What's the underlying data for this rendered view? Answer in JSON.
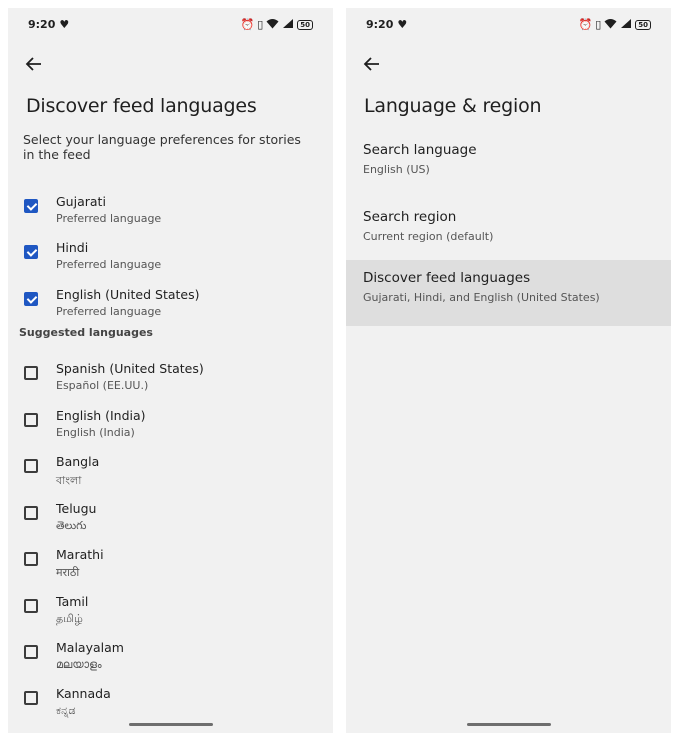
{
  "status": {
    "time": "9:20",
    "battery": "50"
  },
  "left": {
    "title": "Discover feed languages",
    "subtitle": "Select your language preferences for stories in the feed",
    "preferred": [
      {
        "name": "Gujarati",
        "sub": "Preferred language",
        "checked": true
      },
      {
        "name": "Hindi",
        "sub": "Preferred language",
        "checked": true
      },
      {
        "name": "English (United States)",
        "sub": "Preferred language",
        "checked": true
      }
    ],
    "section_label": "Suggested languages",
    "suggested": [
      {
        "name": "Spanish (United States)",
        "sub": "Español (EE.UU.)",
        "checked": false
      },
      {
        "name": "English (India)",
        "sub": "English (India)",
        "checked": false
      },
      {
        "name": "Bangla",
        "sub": "বাংলা",
        "checked": false
      },
      {
        "name": "Telugu",
        "sub": "తెలుగు",
        "checked": false
      },
      {
        "name": "Marathi",
        "sub": "मराठी",
        "checked": false
      },
      {
        "name": "Tamil",
        "sub": "தமிழ்",
        "checked": false
      },
      {
        "name": "Malayalam",
        "sub": "മലയാളം",
        "checked": false
      },
      {
        "name": "Kannada",
        "sub": "ಕನ್ನಡ",
        "checked": false
      }
    ]
  },
  "right": {
    "title": "Language & region",
    "items": [
      {
        "name": "Search language",
        "sub": "English (US)"
      },
      {
        "name": "Search region",
        "sub": "Current region (default)"
      },
      {
        "name": "Discover feed languages",
        "sub": "Gujarati, Hindi, and English (United States)"
      }
    ]
  }
}
